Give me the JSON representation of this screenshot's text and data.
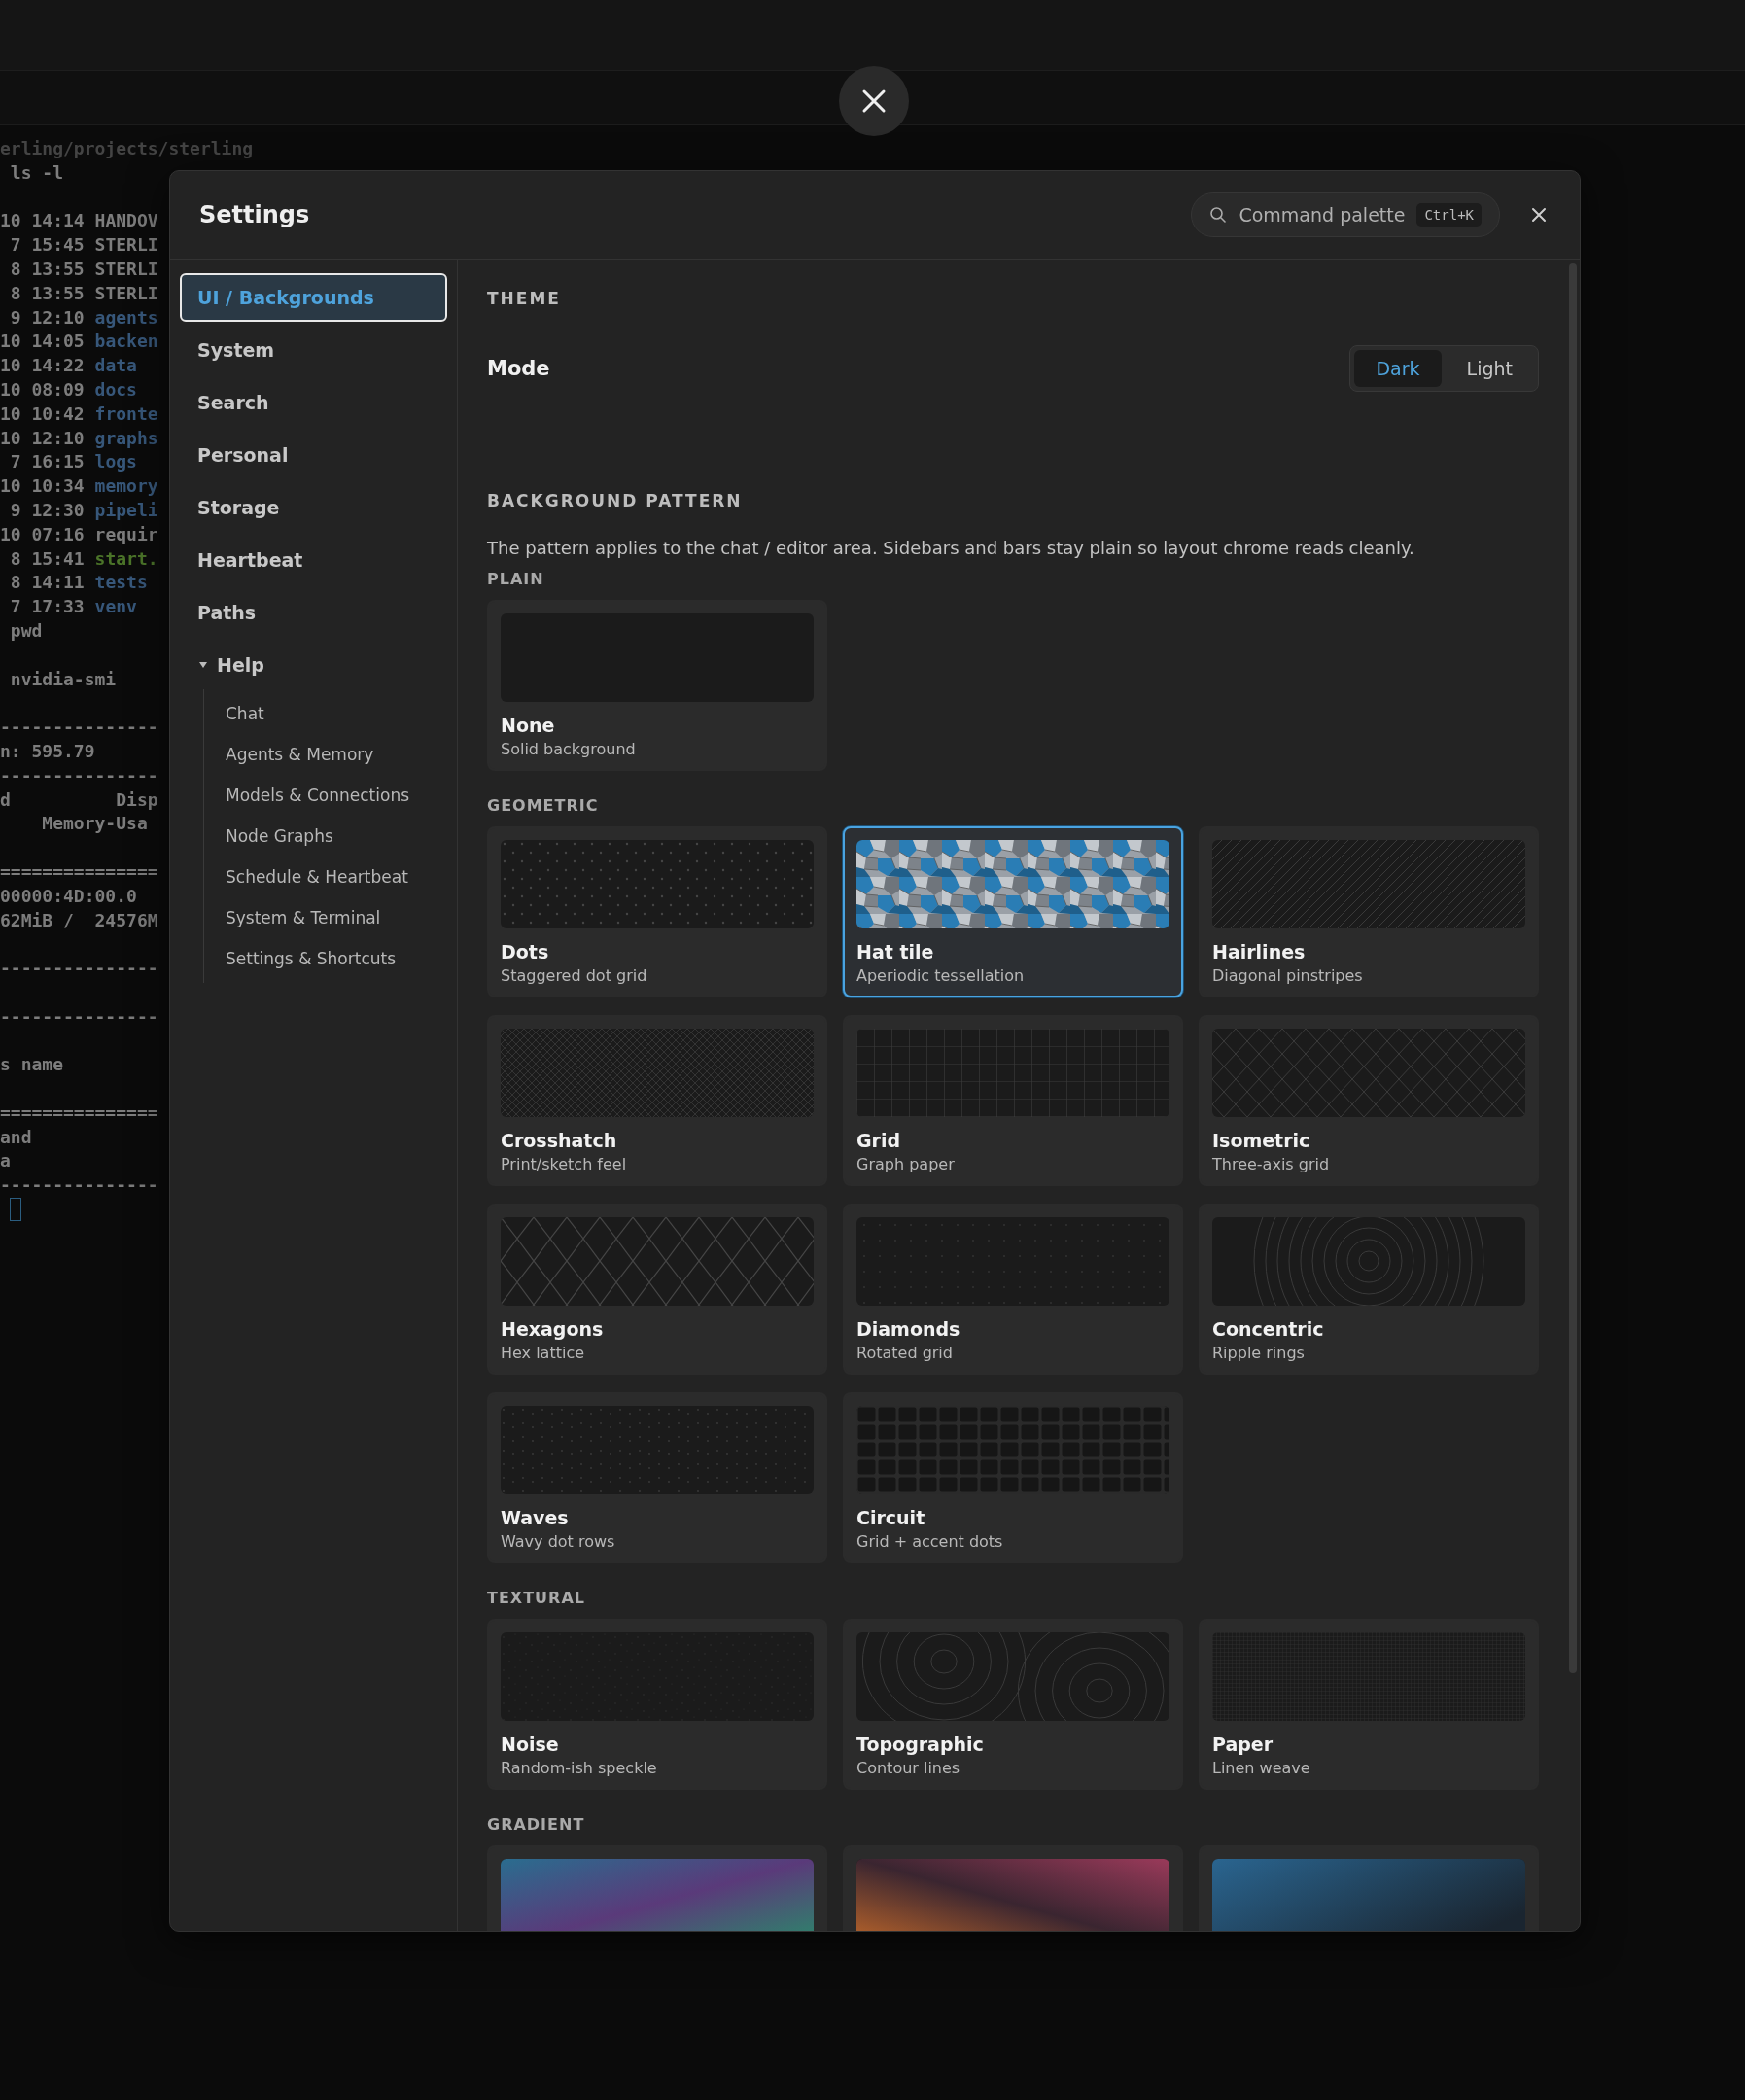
{
  "terminal": {
    "lines": [
      {
        "text": "erling/projects/sterling",
        "kind": "dim"
      },
      {
        "text": " ls -l",
        "kind": "plain"
      },
      {
        "kind": "blank"
      },
      {
        "text": "10 14:14 ",
        "name": "HANDOV",
        "kind": "file"
      },
      {
        "text": " 7 15:45 ",
        "name": "STERLI",
        "kind": "file"
      },
      {
        "text": " 8 13:55 ",
        "name": "STERLI",
        "kind": "file"
      },
      {
        "text": " 8 13:55 ",
        "name": "STERLI",
        "kind": "file"
      },
      {
        "text": " 9 12:10 ",
        "name": "agents",
        "kind": "dir"
      },
      {
        "text": "10 14:05 ",
        "name": "backen",
        "kind": "dir"
      },
      {
        "text": "10 14:22 ",
        "name": "data",
        "kind": "dir"
      },
      {
        "text": "10 08:09 ",
        "name": "docs",
        "kind": "dir"
      },
      {
        "text": "10 10:42 ",
        "name": "fronte",
        "kind": "dir"
      },
      {
        "text": "10 12:10 ",
        "name": "graphs",
        "kind": "dir"
      },
      {
        "text": " 7 16:15 ",
        "name": "logs",
        "kind": "dir"
      },
      {
        "text": "10 10:34 ",
        "name": "memory",
        "kind": "dir"
      },
      {
        "text": " 9 12:30 ",
        "name": "pipeli",
        "kind": "dir"
      },
      {
        "text": "10 07:16 ",
        "name": "requir",
        "kind": "file"
      },
      {
        "text": " 8 15:41 ",
        "name": "start.",
        "kind": "exec"
      },
      {
        "text": " 8 14:11 ",
        "name": "tests",
        "kind": "dir"
      },
      {
        "text": " 7 17:33 ",
        "name": "venv",
        "kind": "dir"
      },
      {
        "text": " pwd",
        "kind": "plain"
      },
      {
        "kind": "blank"
      },
      {
        "text": " nvidia-smi",
        "kind": "plain"
      },
      {
        "kind": "blank"
      },
      {
        "text": "---------------",
        "kind": "plain"
      },
      {
        "text": "n: 595.79",
        "kind": "plain"
      },
      {
        "text": "---------------",
        "kind": "plain"
      },
      {
        "text": "d          Disp",
        "kind": "plain"
      },
      {
        "text": "    Memory-Usa",
        "kind": "plain"
      },
      {
        "kind": "blank"
      },
      {
        "text": "===============",
        "kind": "plain"
      },
      {
        "text": "00000:4D:00.0",
        "kind": "plain"
      },
      {
        "text": "62MiB /  24576M",
        "kind": "plain"
      },
      {
        "kind": "blank"
      },
      {
        "text": "---------------",
        "kind": "plain"
      },
      {
        "kind": "blank"
      },
      {
        "text": "---------------",
        "kind": "plain"
      },
      {
        "kind": "blank"
      },
      {
        "text": "s name",
        "kind": "plain"
      },
      {
        "kind": "blank"
      },
      {
        "text": "===============",
        "kind": "plain"
      },
      {
        "text": "and",
        "kind": "plain"
      },
      {
        "text": "a",
        "kind": "plain"
      },
      {
        "text": "---------------",
        "kind": "plain"
      }
    ]
  },
  "settings": {
    "title": "Settings",
    "command_palette": {
      "label": "Command palette",
      "shortcut": "Ctrl+K"
    },
    "sidebar": {
      "items": [
        {
          "label": "UI / Backgrounds",
          "selected": true
        },
        {
          "label": "System",
          "selected": false
        },
        {
          "label": "Search",
          "selected": false
        },
        {
          "label": "Personal",
          "selected": false
        },
        {
          "label": "Storage",
          "selected": false
        },
        {
          "label": "Heartbeat",
          "selected": false
        },
        {
          "label": "Paths",
          "selected": false
        },
        {
          "label": "Help",
          "selected": false,
          "expanded": true,
          "children": [
            {
              "label": "Chat",
              "selected": false
            },
            {
              "label": "Agents & Memory",
              "selected": false
            },
            {
              "label": "Models & Connections",
              "selected": false
            },
            {
              "label": "Node Graphs",
              "selected": false
            },
            {
              "label": "Schedule & Heartbeat",
              "selected": false
            },
            {
              "label": "System & Terminal",
              "selected": false
            },
            {
              "label": "Settings & Shortcuts",
              "selected": false
            }
          ]
        }
      ]
    },
    "theme": {
      "heading": "THEME",
      "mode": {
        "label": "Mode",
        "options": [
          {
            "label": "Dark",
            "selected": true
          },
          {
            "label": "Light",
            "selected": false
          }
        ]
      }
    },
    "background_pattern": {
      "heading": "BACKGROUND PATTERN",
      "description": "The pattern applies to the chat / editor area. Sidebars and bars stay plain so layout chrome reads cleanly.",
      "groups": [
        {
          "heading": "PLAIN",
          "options": [
            {
              "kind": "solid",
              "title": "None",
              "subtitle": "Solid background",
              "selected": false
            }
          ]
        },
        {
          "heading": "GEOMETRIC",
          "options": [
            {
              "kind": "dots",
              "title": "Dots",
              "subtitle": "Staggered dot grid",
              "selected": false
            },
            {
              "kind": "hat",
              "title": "Hat tile",
              "subtitle": "Aperiodic tessellation",
              "selected": true
            },
            {
              "kind": "hairlines",
              "title": "Hairlines",
              "subtitle": "Diagonal pinstripes",
              "selected": false
            },
            {
              "kind": "crosshatch",
              "title": "Crosshatch",
              "subtitle": "Print/sketch feel",
              "selected": false
            },
            {
              "kind": "grid",
              "title": "Grid",
              "subtitle": "Graph paper",
              "selected": false
            },
            {
              "kind": "isometric",
              "title": "Isometric",
              "subtitle": "Three-axis grid",
              "selected": false
            },
            {
              "kind": "hexagons",
              "title": "Hexagons",
              "subtitle": "Hex lattice",
              "selected": false
            },
            {
              "kind": "diamonds",
              "title": "Diamonds",
              "subtitle": "Rotated grid",
              "selected": false
            },
            {
              "kind": "concentric",
              "title": "Concentric",
              "subtitle": "Ripple rings",
              "selected": false
            },
            {
              "kind": "waves",
              "title": "Waves",
              "subtitle": "Wavy dot rows",
              "selected": false
            },
            {
              "kind": "circuit",
              "title": "Circuit",
              "subtitle": "Grid + accent dots",
              "selected": false
            }
          ]
        },
        {
          "heading": "TEXTURAL",
          "options": [
            {
              "kind": "noise",
              "title": "Noise",
              "subtitle": "Random-ish speckle",
              "selected": false
            },
            {
              "kind": "topographic",
              "title": "Topographic",
              "subtitle": "Contour lines",
              "selected": false
            },
            {
              "kind": "paper",
              "title": "Paper",
              "subtitle": "Linen weave",
              "selected": false
            }
          ]
        },
        {
          "heading": "GRADIENT",
          "options": [
            {
              "kind": "aurora",
              "selected": false
            },
            {
              "kind": "sunset",
              "selected": false
            },
            {
              "kind": "ocean",
              "selected": false
            }
          ]
        }
      ]
    }
  }
}
